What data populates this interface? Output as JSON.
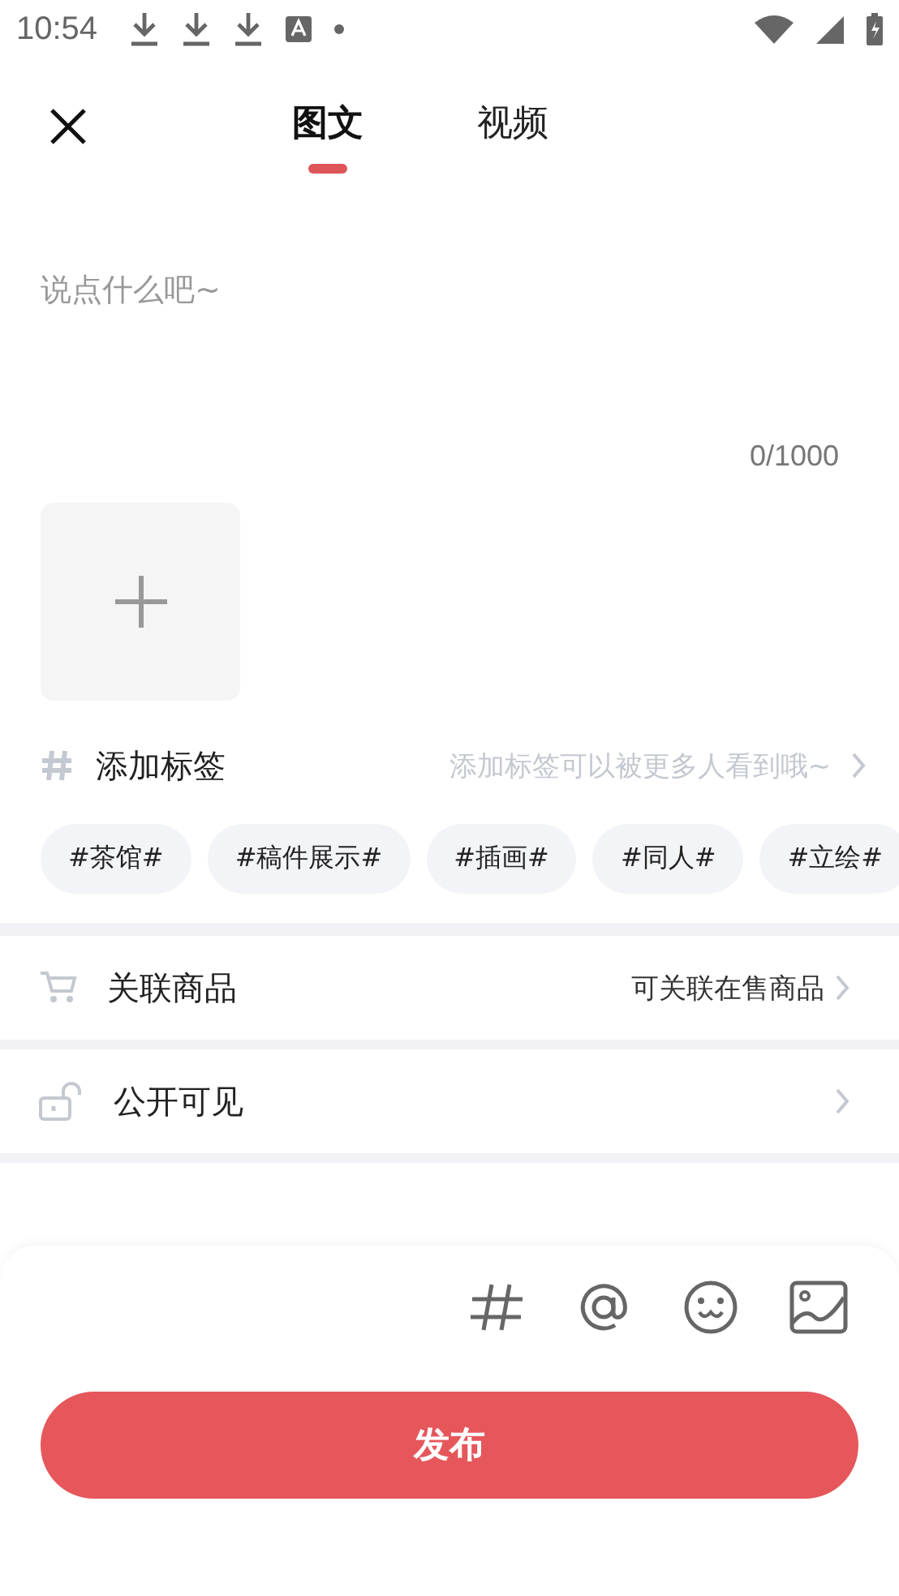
{
  "status_bar": {
    "time": "10:54"
  },
  "header": {
    "tabs": [
      {
        "label": "图文",
        "selected": true
      },
      {
        "label": "视频",
        "selected": false
      }
    ]
  },
  "editor": {
    "placeholder": "说点什么吧~",
    "counter": "0/1000"
  },
  "tags": {
    "label": "添加标签",
    "hint": "添加标签可以被更多人看到哦~",
    "chips": [
      "#茶馆#",
      "#稿件展示#",
      "#插画#",
      "#同人#",
      "#立绘#"
    ]
  },
  "settings": [
    {
      "kind": "cart",
      "label": "关联商品",
      "value": "可关联在售商品"
    },
    {
      "kind": "lock",
      "label": "公开可见"
    }
  ],
  "publish_button": "发布"
}
